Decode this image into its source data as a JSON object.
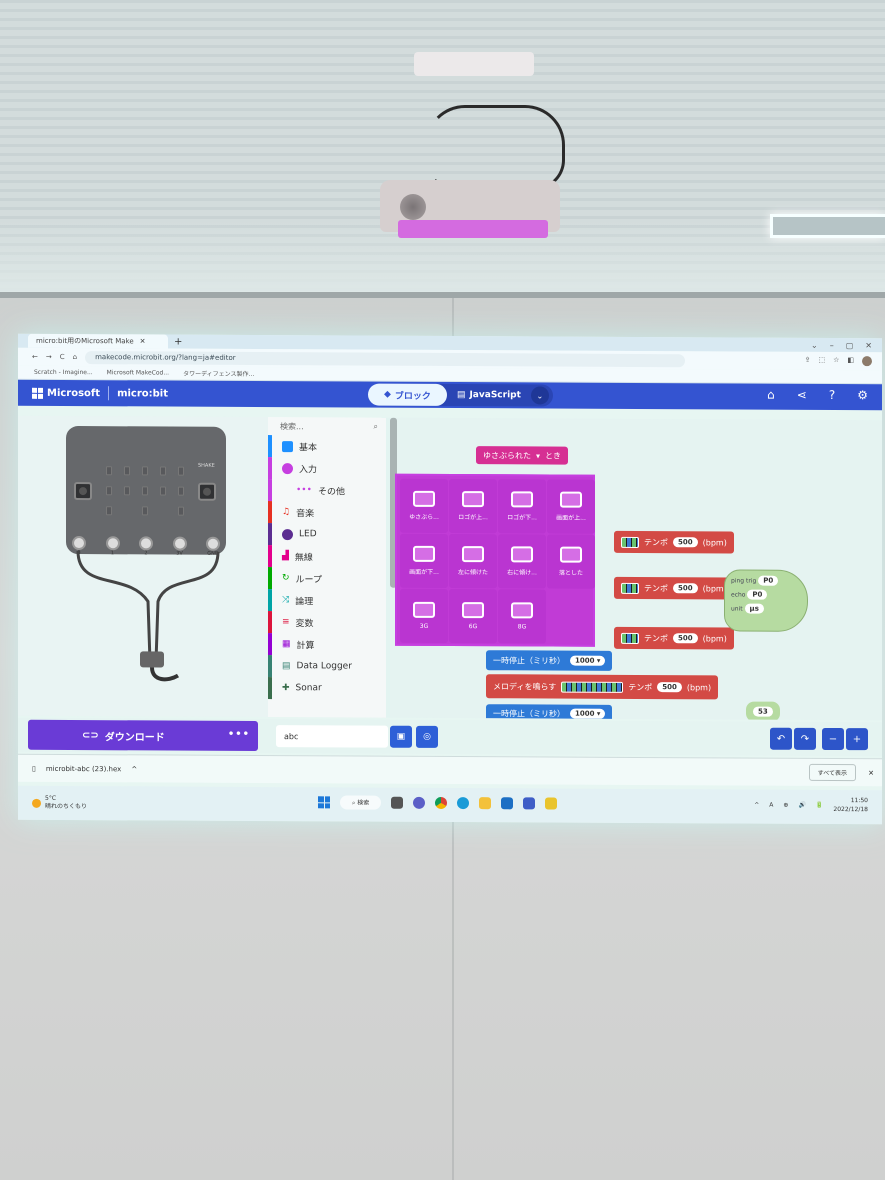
{
  "browser": {
    "tab_title": "micro:bit用のMicrosoft Make",
    "tab_plus": "+",
    "window_controls": [
      "⌄",
      "–",
      "▢",
      "✕"
    ],
    "nav": [
      "←",
      "→",
      "C",
      "⌂"
    ],
    "url": "makecode.microbit.org/?lang=ja#editor",
    "bookmarks": [
      "Scratch - Imagine...",
      "Microsoft MakeCod...",
      "タワーディフェンス製作..."
    ],
    "toolbar_icons": [
      "⇪",
      "⬚",
      "☆",
      "◧"
    ]
  },
  "makecode": {
    "brand": "Microsoft",
    "product": "micro:bit",
    "blocks_label": "ブロック",
    "js_label": "JavaScript",
    "header_icons": [
      "home-icon",
      "share-icon",
      "help-icon",
      "settings-icon"
    ]
  },
  "simulator": {
    "shake_label": "SHAKE",
    "pins": [
      "0",
      "1",
      "2",
      "3V",
      "GND"
    ],
    "download_label": "ダウンロード",
    "more": "•••"
  },
  "toolbox": {
    "search_placeholder": "検索...",
    "items": [
      {
        "label": "基本",
        "color": "#1e90ff"
      },
      {
        "label": "入力",
        "color": "#c63fe0"
      },
      {
        "label": "その他",
        "color": "#c63fe0"
      },
      {
        "label": "音楽",
        "color": "#e63022"
      },
      {
        "label": "LED",
        "color": "#5c2d91"
      },
      {
        "label": "無線",
        "color": "#e3008c"
      },
      {
        "label": "ループ",
        "color": "#00aa00"
      },
      {
        "label": "論理",
        "color": "#00a4a6"
      },
      {
        "label": "変数",
        "color": "#dc143c"
      },
      {
        "label": "計算",
        "color": "#9400d3"
      },
      {
        "label": "Data Logger",
        "color": "#378273"
      },
      {
        "label": "Sonar",
        "color": "#3a6e4d"
      }
    ]
  },
  "blocks": {
    "event_block": "ゆさぶられた",
    "event_suffix": "とき",
    "tempo_label": "テンポ",
    "tempo_value": "500",
    "bpm": "(bpm)",
    "pause_label": "一時停止（ミリ秒）",
    "pause_value": "1000",
    "melody_label": "メロディを鳴らす",
    "sonar_trig": "ping trig",
    "sonar_trig_pin": "P0",
    "sonar_echo": "echo",
    "sonar_echo_pin": "P0",
    "sonar_unit": "unit",
    "sonar_unit_value": "μs",
    "number_block_value": "53"
  },
  "flyout": {
    "items": [
      "ゆさぶら...",
      "ロゴが上...",
      "ロゴが下...",
      "画面が上...",
      "画面が下...",
      "左に傾けた",
      "右に傾け...",
      "落とした",
      "3G",
      "6G",
      "8G"
    ]
  },
  "editor_bottom": {
    "project_name": "abc",
    "save_icon": "save-icon",
    "github_icon": "github-icon",
    "undo": "↶",
    "redo": "↷",
    "zoom_out": "−",
    "zoom_in": "+"
  },
  "download_shelf": {
    "file_name": "microbit-abc (23).hex",
    "chevron": "^",
    "show_all": "すべて表示",
    "close": "✕"
  },
  "taskbar": {
    "temperature": "5°C",
    "weather": "晴れのちくもり",
    "search_label": "検索",
    "time": "11:50",
    "date": "2022/12/18",
    "tray": [
      "^",
      "A",
      "⊕",
      "🔊",
      "🔋"
    ]
  }
}
